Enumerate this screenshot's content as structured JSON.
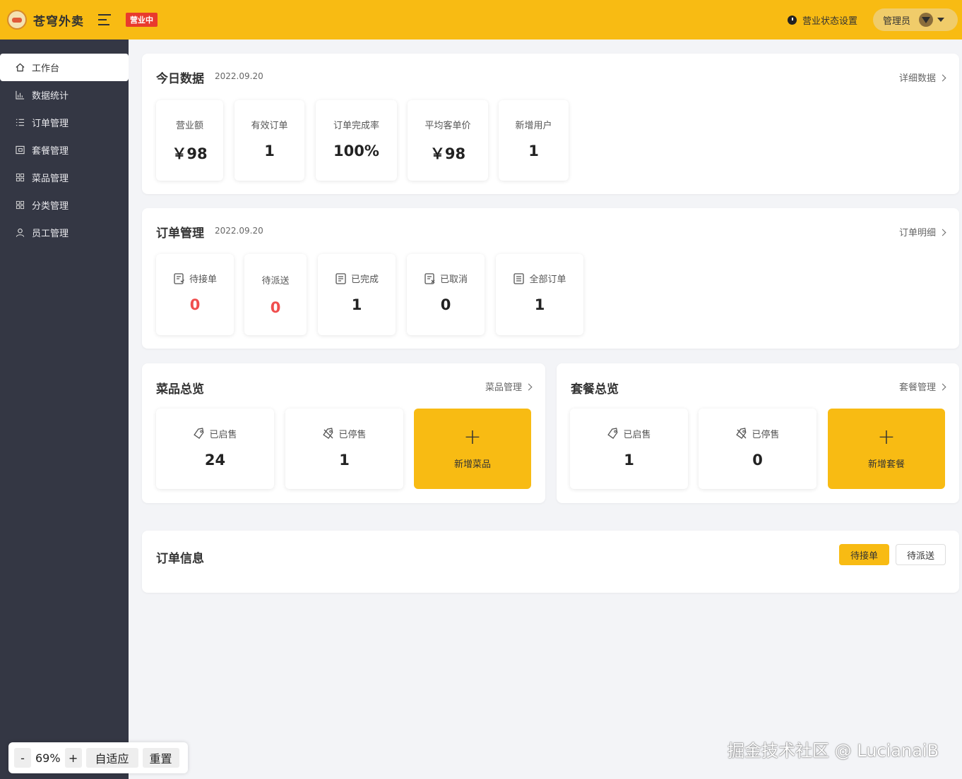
{
  "header": {
    "app_name": "苍穹外卖",
    "status_badge": "营业中",
    "status_setting": "营业状态设置",
    "admin_label": "管理员"
  },
  "sidebar": {
    "items": [
      {
        "label": "工作台",
        "icon": "home-icon"
      },
      {
        "label": "数据统计",
        "icon": "bar-chart-icon"
      },
      {
        "label": "订单管理",
        "icon": "list-icon"
      },
      {
        "label": "套餐管理",
        "icon": "package-icon"
      },
      {
        "label": "菜品管理",
        "icon": "grid-icon"
      },
      {
        "label": "分类管理",
        "icon": "grid-icon"
      },
      {
        "label": "员工管理",
        "icon": "user-icon"
      }
    ]
  },
  "today": {
    "title": "今日数据",
    "date": "2022.09.20",
    "link": "详细数据",
    "stats": [
      {
        "label": "营业额",
        "value": "￥98"
      },
      {
        "label": "有效订单",
        "value": "1"
      },
      {
        "label": "订单完成率",
        "value": "100%"
      },
      {
        "label": "平均客单价",
        "value": "￥98"
      },
      {
        "label": "新增用户",
        "value": "1"
      }
    ]
  },
  "orders": {
    "title": "订单管理",
    "date": "2022.09.20",
    "link": "订单明细",
    "stats": [
      {
        "label": "待接单",
        "value": "0"
      },
      {
        "label": "待派送",
        "value": "0"
      },
      {
        "label": "已完成",
        "value": "1"
      },
      {
        "label": "已取消",
        "value": "0"
      },
      {
        "label": "全部订单",
        "value": "1"
      }
    ]
  },
  "dishes": {
    "title": "菜品总览",
    "link": "菜品管理",
    "on_label": "已启售",
    "on_value": "24",
    "off_label": "已停售",
    "off_value": "1",
    "add_label": "新增菜品"
  },
  "setmeals": {
    "title": "套餐总览",
    "link": "套餐管理",
    "on_label": "已启售",
    "on_value": "1",
    "off_label": "已停售",
    "off_value": "0",
    "add_label": "新增套餐"
  },
  "order_info": {
    "title": "订单信息",
    "tab_pending": "待接单",
    "tab_delivery": "待派送"
  },
  "zoom": {
    "minus": "-",
    "value": "69%",
    "plus": "+",
    "fit": "自适应",
    "reset": "重置"
  },
  "watermark": "掘金技术社区 @ LucianaiB"
}
